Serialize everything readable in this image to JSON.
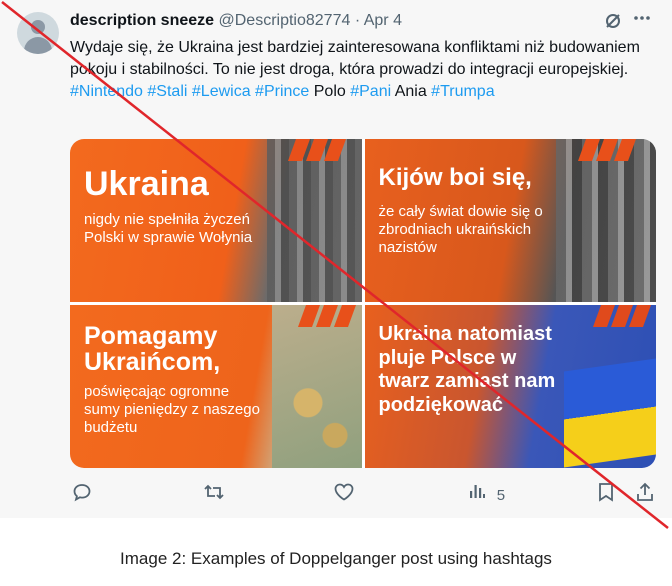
{
  "author": {
    "name": "description sneeze",
    "handle": "@Descriptio82774",
    "separator": "·",
    "date": "Apr 4"
  },
  "post": {
    "text_parts": [
      {
        "text": "Wydaje się, że Ukraina jest bardziej zainteresowana konfliktami niż budowaniem pokoju i stabilności. To nie jest droga, która prowadzi do integracji europejskiej. ",
        "tag": false
      },
      {
        "text": "#Nintendo",
        "tag": true
      },
      {
        "text": " ",
        "tag": false
      },
      {
        "text": "#Stali",
        "tag": true
      },
      {
        "text": " ",
        "tag": false
      },
      {
        "text": "#Lewica",
        "tag": true
      },
      {
        "text": " ",
        "tag": false
      },
      {
        "text": "#Prince",
        "tag": true
      },
      {
        "text": " Polo ",
        "tag": false
      },
      {
        "text": "#Pani",
        "tag": true
      },
      {
        "text": " Ania ",
        "tag": false
      },
      {
        "text": "#Trumpa",
        "tag": true
      }
    ]
  },
  "images": [
    {
      "headline": "Ukraina",
      "subtext": "nigdy nie spełniła życzeń Polski w sprawie Wołynia"
    },
    {
      "headline": "Kijów boi się,",
      "subtext": "że cały świat dowie się o zbrodniach ukraińskich nazistów"
    },
    {
      "headline": "Pomagamy Ukraińcom,",
      "subtext": "poświęcając ogromne sumy pieniędzy z naszego budżetu"
    },
    {
      "headline": "Ukraina natomiast pluje Polsce w twarz zamiast nam podziękować",
      "subtext": ""
    }
  ],
  "actions": {
    "views_count": "5"
  },
  "icons": {
    "grok": "grok-icon",
    "more": "more-icon",
    "reply": "reply-icon",
    "retweet": "retweet-icon",
    "like": "heart-icon",
    "views": "views-icon",
    "bookmark": "bookmark-icon",
    "share": "share-icon"
  },
  "colors": {
    "hashtag": "#1d9bf0",
    "strike_line": "#e0262b",
    "tile_orange": "#f36a1e"
  },
  "caption": "Image 2: Examples of Doppelganger post using hashtags"
}
